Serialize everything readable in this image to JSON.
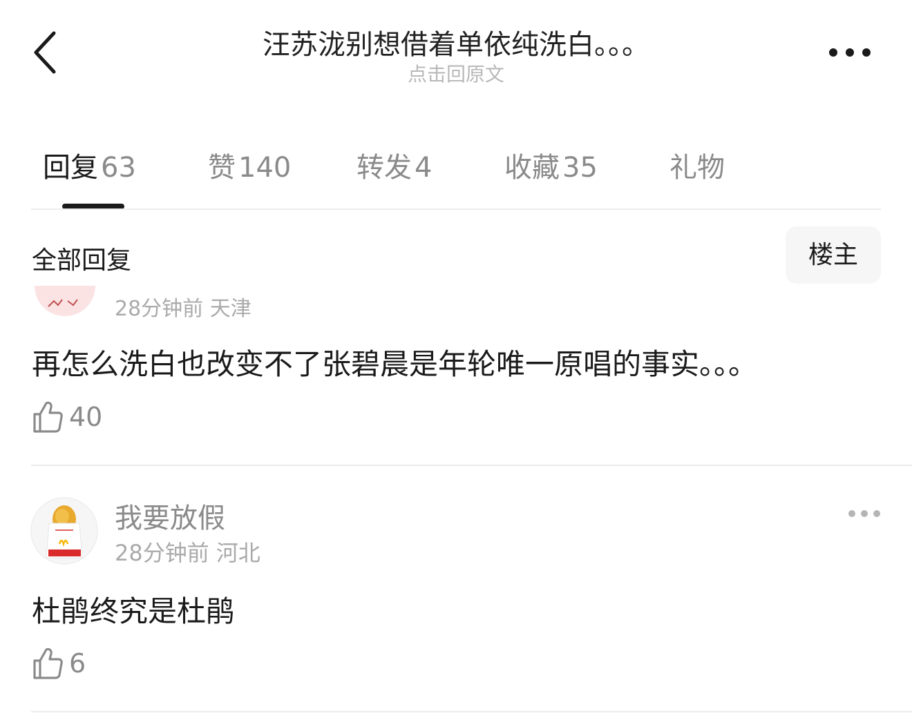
{
  "nav": {
    "title": "汪苏泷别想借着单依纯洗白。。。",
    "subtitle": "点击回原文"
  },
  "tabs": [
    {
      "label": "回复",
      "count": "63",
      "active": true
    },
    {
      "label": "赞",
      "count": "140",
      "active": false
    },
    {
      "label": "转发",
      "count": "4",
      "active": false
    },
    {
      "label": "收藏",
      "count": "35",
      "active": false
    },
    {
      "label": "礼物",
      "count": "",
      "active": false
    }
  ],
  "section": {
    "title": "全部回复",
    "filter_label": "楼主"
  },
  "comments": [
    {
      "meta": "28分钟前 天津",
      "text": "再怎么洗白也改变不了张碧晨是年轮唯一原唱的事实。。。",
      "likes": "40"
    },
    {
      "username": "我要放假",
      "meta": "28分钟前 河北",
      "text": "杜鹃终究是杜鹃",
      "likes": "6"
    }
  ],
  "colors": {
    "text_primary": "#1a1a1a",
    "text_secondary": "#8a8a8a",
    "text_muted": "#aaaaaa",
    "divider": "#ececec",
    "button_bg": "#f6f6f6"
  },
  "icons": {
    "back": "chevron-left-icon",
    "more": "more-horizontal-icon",
    "like": "thumbs-up-icon"
  }
}
